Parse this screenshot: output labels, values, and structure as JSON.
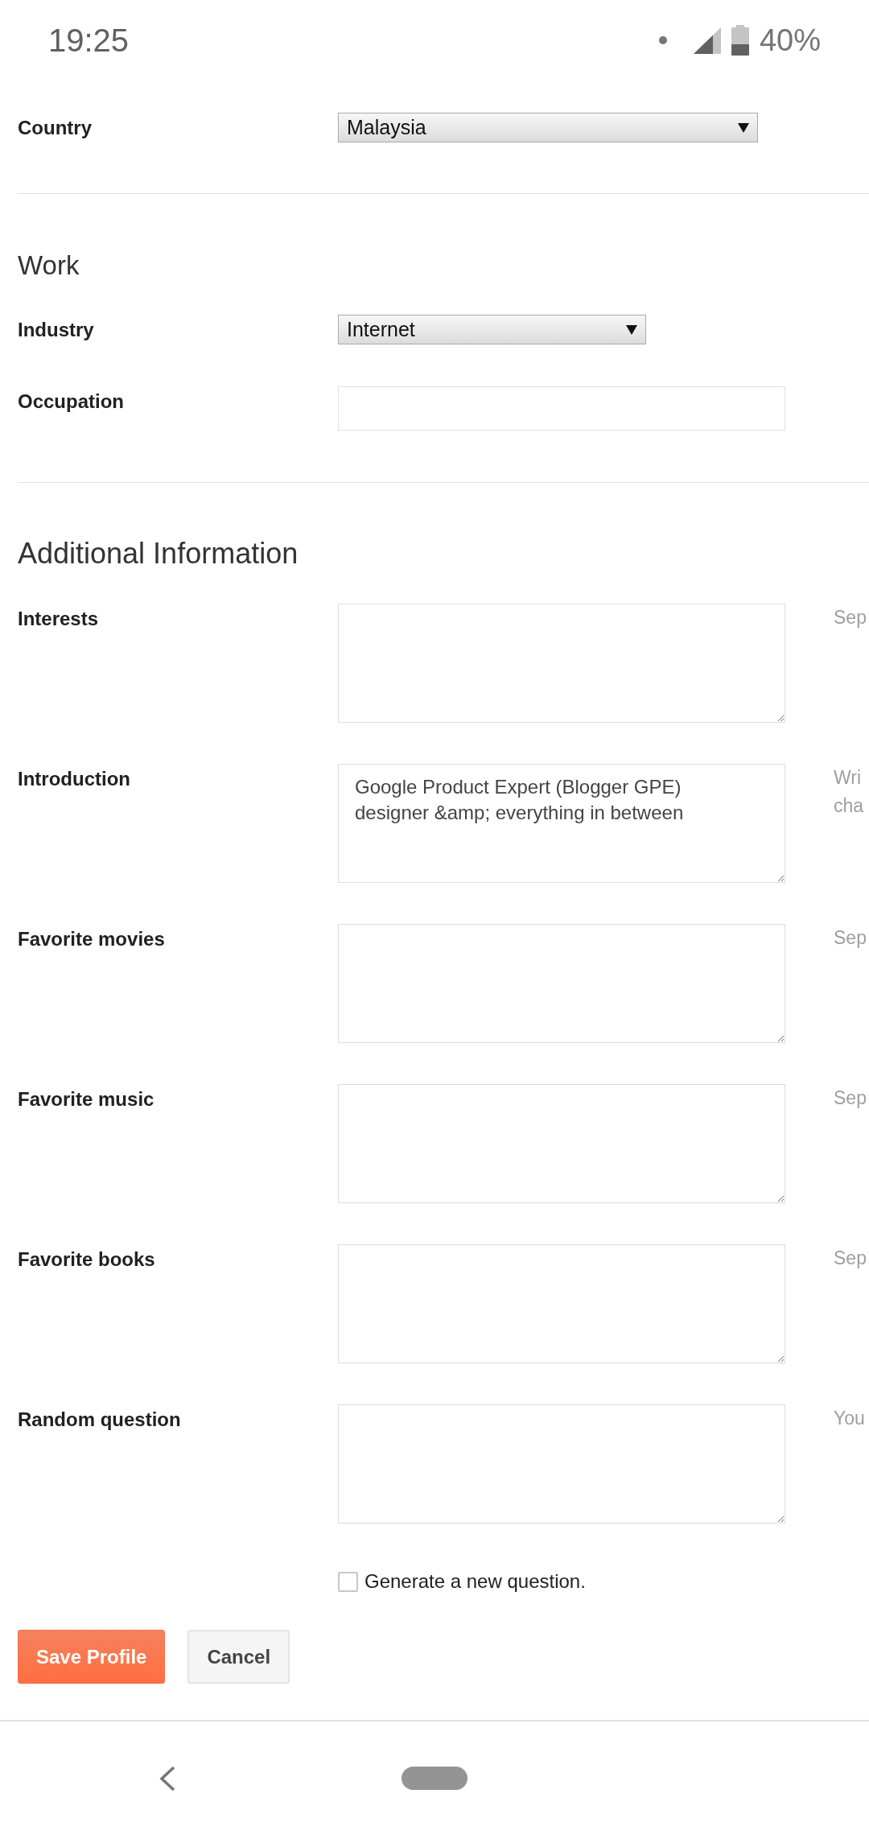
{
  "status_bar": {
    "time": "19:25",
    "battery": "40%"
  },
  "sections": [
    {
      "fields": [
        {
          "kind": "select",
          "label": "Country",
          "value": "Malaysia"
        }
      ]
    },
    {
      "heading": "Work",
      "fields": [
        {
          "kind": "select",
          "label": "Industry",
          "value": "Internet"
        },
        {
          "kind": "input",
          "label": "Occupation"
        }
      ]
    },
    {
      "heading": "Additional Information",
      "fields": [
        {
          "kind": "textarea",
          "label": "Interests",
          "hint": "Sep"
        },
        {
          "kind": "textarea",
          "label": "Introduction",
          "value": "Google Product Expert (Blogger GPE)\ndesigner &amp; everything in between",
          "hint": "Wri cha"
        },
        {
          "kind": "textarea",
          "label": "Favorite movies",
          "hint": "Sep"
        },
        {
          "kind": "textarea",
          "label": "Favorite music",
          "hint": "Sep"
        },
        {
          "kind": "textarea",
          "label": "Favorite books",
          "hint": "Sep"
        },
        {
          "kind": "textarea",
          "label": "Random question",
          "hint": "You"
        }
      ]
    }
  ],
  "checkbox": {
    "label": "Generate a new question.",
    "checked": false
  },
  "buttons": [
    {
      "kind": "primary",
      "label": "Save Profile"
    },
    {
      "kind": "secondary",
      "label": "Cancel"
    }
  ]
}
